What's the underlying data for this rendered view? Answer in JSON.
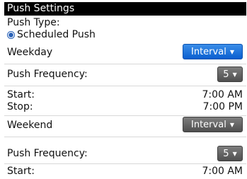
{
  "screen": {
    "title": "Push Settings",
    "push_type_label": "Push Type:",
    "push_type_option": "Scheduled Push",
    "weekday": {
      "label": "Weekday",
      "mode_value": "Interval",
      "frequency_label": "Push Frequency:",
      "frequency_value": "5",
      "start_label": "Start:",
      "start_value": "7:00 AM",
      "stop_label": "Stop:",
      "stop_value": "7:00 PM"
    },
    "weekend": {
      "label": "Weekend",
      "mode_value": "Interval",
      "frequency_label": "Push Frequency:",
      "frequency_value": "5",
      "start_label": "Start:",
      "start_value": "7:00 AM"
    }
  },
  "icons": {
    "dropdown_arrow": "▼",
    "radio_selected": "radio-selected-icon"
  },
  "colors": {
    "title_bar": "#000000",
    "active_dropdown": "#0a5fd0",
    "inactive_dropdown": "#5a5a5a"
  }
}
